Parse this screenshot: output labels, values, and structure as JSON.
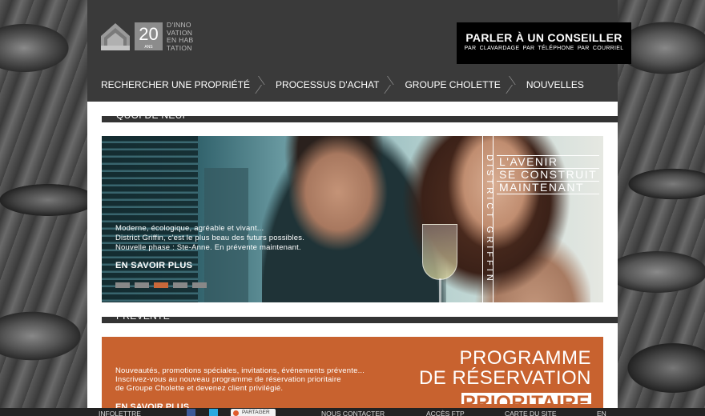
{
  "logo": {
    "number": "20",
    "small": "ANS",
    "tagline": [
      "D'INNO",
      "VATION",
      "EN HAB",
      "TATION"
    ]
  },
  "cta": {
    "title": "PARLER À UN CONSEILLER",
    "subtitle": "PAR CLAVARDAGE  PAR TÉLÉPHONE  PAR COURRIEL"
  },
  "nav": {
    "items": [
      {
        "label": "RECHERCHER UNE PROPRIÉTÉ"
      },
      {
        "label": "PROCESSUS D'ACHAT"
      },
      {
        "label": "GROUPE CHOLETTE"
      },
      {
        "label": "NOUVELLES"
      }
    ]
  },
  "sections": {
    "news_title": "QUOI DE NEUF",
    "presale_title": "PRÉVENTE"
  },
  "hero": {
    "line1": "Moderne, écologique, agréable et vivant...",
    "line2": "District Griffin, c'est le plus beau des futurs possibles.",
    "line3": "Nouvelle phase : Ste-Anne. En prévente maintenant.",
    "more": "EN SAVOIR PLUS",
    "vertical_brand": "DISTRICT GRIFFIN",
    "brand_lines": [
      "L'AVENIR",
      "SE CONSTRUIT",
      "MAINTENANT"
    ],
    "active_slide": 3,
    "slide_count": 5
  },
  "promo": {
    "line1": "Nouveautés, promotions spéciales, invitations, événements prévente...",
    "line2": "Inscrivez-vous au nouveau programme de réservation prioritaire",
    "line3": "de Groupe Cholette et devenez client privilégié.",
    "more": "EN SAVOIR PLUS",
    "big": [
      "PROGRAMME",
      "DE RÉSERVATION",
      "PRIORITAIRE"
    ]
  },
  "footer": {
    "newsletter": "INFOLETTRE",
    "share": "PARTAGER",
    "contact": "NOUS CONTACTER",
    "access": "ACCÈS FTP",
    "sitemap": "CARTE DU SITE",
    "lang": "EN"
  },
  "colors": {
    "accent": "#c8622f",
    "header": "#3a3a3a"
  }
}
